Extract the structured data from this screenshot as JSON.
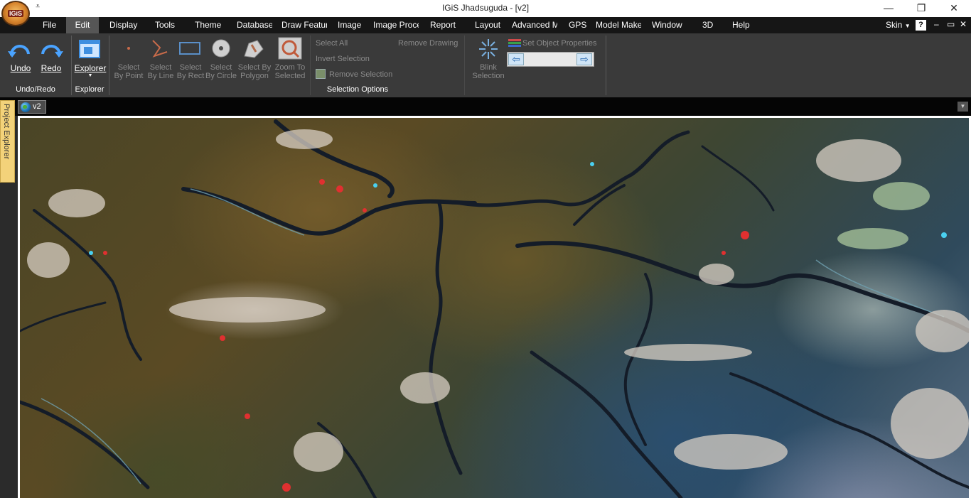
{
  "app": {
    "logo_text": "IGiS",
    "title": "IGiS Jhadsuguda - [v2]",
    "qat_symbol": "⩡"
  },
  "window_controls": {
    "minimize": "—",
    "restore": "❐",
    "close": "✕"
  },
  "menu": {
    "items": [
      "File",
      "Edit",
      "Display",
      "Tools",
      "Theme",
      "Database",
      "Draw Featur",
      "Image",
      "Image Proce",
      "Report",
      "Layout",
      "Advanced M",
      "GPS",
      "Model Make",
      "Window",
      "3D",
      "Help"
    ],
    "active": "Edit",
    "skin_label": "Skin",
    "help_symbol": "?",
    "mini_buttons": [
      "–",
      "▭",
      "✕"
    ]
  },
  "ribbon": {
    "undo_redo": {
      "undo": "Undo",
      "redo": "Redo",
      "group": "Undo/Redo"
    },
    "explorer": {
      "button": "Explorer",
      "group": "Explorer"
    },
    "selection": {
      "by_point": [
        "Select",
        "By Point"
      ],
      "by_line": [
        "Select",
        "By Line"
      ],
      "by_rect": [
        "Select",
        "By Rect"
      ],
      "by_circle": [
        "Select",
        "By Circle"
      ],
      "by_polygon": [
        "Select By",
        "Polygon"
      ],
      "zoom_selected": [
        "Zoom To",
        "Selected"
      ],
      "select_all": "Select All",
      "invert": "Invert Selection",
      "remove_selection": "Remove Selection",
      "remove_drawing": "Remove Drawing",
      "blink": [
        "Blink",
        "Selection"
      ],
      "set_props": "Set Object Properties",
      "group": "Selection Options"
    }
  },
  "document": {
    "tab": "v2"
  },
  "side_panel": {
    "label": "Project Explorer"
  }
}
